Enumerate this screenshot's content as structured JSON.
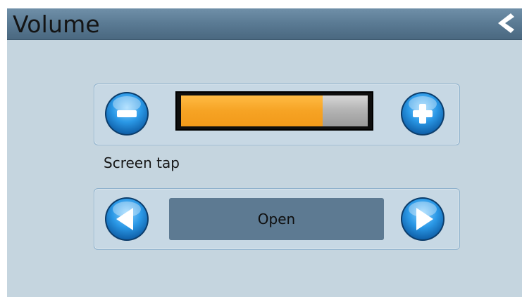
{
  "header": {
    "title": "Volume",
    "back_icon": "chevron-left-icon"
  },
  "volume": {
    "level": 0.76,
    "decrease_icon": "minus-icon",
    "increase_icon": "plus-icon",
    "fill_color": "#f6a324"
  },
  "screen_tap": {
    "label": "Screen tap",
    "value": "Open",
    "prev_icon": "arrow-left-icon",
    "next_icon": "arrow-right-icon"
  },
  "colors": {
    "background": "#c5d5df",
    "header": "#587891",
    "button_blue": "#1e8fe0"
  }
}
